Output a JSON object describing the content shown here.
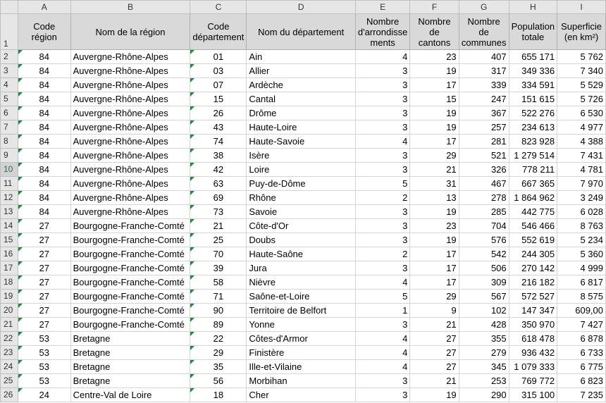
{
  "columns": [
    "A",
    "B",
    "C",
    "D",
    "E",
    "F",
    "G",
    "H",
    "I"
  ],
  "header_row_number": "1",
  "headers": [
    "Code région",
    "Nom de la région",
    "Code département",
    "Nom du département",
    "Nombre d'arrondisse ments",
    "Nombre de cantons",
    "Nombre de communes",
    "Population totale",
    "Superficie (en km²)"
  ],
  "selected_row": "10",
  "rows": [
    {
      "n": "2",
      "cells": [
        "84",
        "Auvergne-Rhône-Alpes",
        "01",
        "Ain",
        "4",
        "23",
        "407",
        "655 171",
        "5 762"
      ]
    },
    {
      "n": "3",
      "cells": [
        "84",
        "Auvergne-Rhône-Alpes",
        "03",
        "Allier",
        "3",
        "19",
        "317",
        "349 336",
        "7 340"
      ]
    },
    {
      "n": "4",
      "cells": [
        "84",
        "Auvergne-Rhône-Alpes",
        "07",
        "Ardèche",
        "3",
        "17",
        "339",
        "334 591",
        "5 529"
      ]
    },
    {
      "n": "5",
      "cells": [
        "84",
        "Auvergne-Rhône-Alpes",
        "15",
        "Cantal",
        "3",
        "15",
        "247",
        "151 615",
        "5 726"
      ]
    },
    {
      "n": "6",
      "cells": [
        "84",
        "Auvergne-Rhône-Alpes",
        "26",
        "Drôme",
        "3",
        "19",
        "367",
        "522 276",
        "6 530"
      ]
    },
    {
      "n": "7",
      "cells": [
        "84",
        "Auvergne-Rhône-Alpes",
        "43",
        "Haute-Loire",
        "3",
        "19",
        "257",
        "234 613",
        "4 977"
      ]
    },
    {
      "n": "8",
      "cells": [
        "84",
        "Auvergne-Rhône-Alpes",
        "74",
        "Haute-Savoie",
        "4",
        "17",
        "281",
        "823 928",
        "4 388"
      ]
    },
    {
      "n": "9",
      "cells": [
        "84",
        "Auvergne-Rhône-Alpes",
        "38",
        "Isère",
        "3",
        "29",
        "521",
        "1 279 514",
        "7 431"
      ]
    },
    {
      "n": "10",
      "cells": [
        "84",
        "Auvergne-Rhône-Alpes",
        "42",
        "Loire",
        "3",
        "21",
        "326",
        "778 211",
        "4 781"
      ]
    },
    {
      "n": "11",
      "cells": [
        "84",
        "Auvergne-Rhône-Alpes",
        "63",
        "Puy-de-Dôme",
        "5",
        "31",
        "467",
        "667 365",
        "7 970"
      ]
    },
    {
      "n": "12",
      "cells": [
        "84",
        "Auvergne-Rhône-Alpes",
        "69",
        "Rhône",
        "2",
        "13",
        "278",
        "1 864 962",
        "3 249"
      ]
    },
    {
      "n": "13",
      "cells": [
        "84",
        "Auvergne-Rhône-Alpes",
        "73",
        "Savoie",
        "3",
        "19",
        "285",
        "442 775",
        "6 028"
      ]
    },
    {
      "n": "14",
      "cells": [
        "27",
        "Bourgogne-Franche-Comté",
        "21",
        "Côte-d'Or",
        "3",
        "23",
        "704",
        "546 466",
        "8 763"
      ]
    },
    {
      "n": "15",
      "cells": [
        "27",
        "Bourgogne-Franche-Comté",
        "25",
        "Doubs",
        "3",
        "19",
        "576",
        "552 619",
        "5 234"
      ]
    },
    {
      "n": "16",
      "cells": [
        "27",
        "Bourgogne-Franche-Comté",
        "70",
        "Haute-Saône",
        "2",
        "17",
        "542",
        "244 305",
        "5 360"
      ]
    },
    {
      "n": "17",
      "cells": [
        "27",
        "Bourgogne-Franche-Comté",
        "39",
        "Jura",
        "3",
        "17",
        "506",
        "270 142",
        "4 999"
      ]
    },
    {
      "n": "18",
      "cells": [
        "27",
        "Bourgogne-Franche-Comté",
        "58",
        "Nièvre",
        "4",
        "17",
        "309",
        "216 182",
        "6 817"
      ]
    },
    {
      "n": "19",
      "cells": [
        "27",
        "Bourgogne-Franche-Comté",
        "71",
        "Saône-et-Loire",
        "5",
        "29",
        "567",
        "572 527",
        "8 575"
      ]
    },
    {
      "n": "20",
      "cells": [
        "27",
        "Bourgogne-Franche-Comté",
        "90",
        "Territoire de Belfort",
        "1",
        "9",
        "102",
        "147 347",
        "609,00"
      ]
    },
    {
      "n": "21",
      "cells": [
        "27",
        "Bourgogne-Franche-Comté",
        "89",
        "Yonne",
        "3",
        "21",
        "428",
        "350 970",
        "7 427"
      ]
    },
    {
      "n": "22",
      "cells": [
        "53",
        "Bretagne",
        "22",
        "Côtes-d'Armor",
        "4",
        "27",
        "355",
        "618 478",
        "6 878"
      ]
    },
    {
      "n": "23",
      "cells": [
        "53",
        "Bretagne",
        "29",
        "Finistère",
        "4",
        "27",
        "279",
        "936 432",
        "6 733"
      ]
    },
    {
      "n": "24",
      "cells": [
        "53",
        "Bretagne",
        "35",
        "Ille-et-Vilaine",
        "4",
        "27",
        "345",
        "1 079 333",
        "6 775"
      ]
    },
    {
      "n": "25",
      "cells": [
        "53",
        "Bretagne",
        "56",
        "Morbihan",
        "3",
        "21",
        "253",
        "769 772",
        "6 823"
      ]
    },
    {
      "n": "26",
      "cells": [
        "24",
        "Centre-Val de Loire",
        "18",
        "Cher",
        "3",
        "19",
        "290",
        "315 100",
        "7 235"
      ]
    }
  ]
}
